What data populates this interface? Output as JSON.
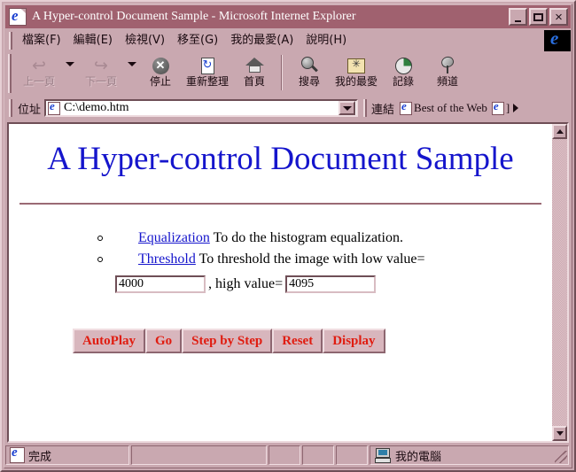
{
  "window": {
    "title": "A Hyper-control Document Sample - Microsoft Internet Explorer",
    "icon": "ie-document-icon",
    "minimize_label": "",
    "maximize_label": "",
    "close_label": "×"
  },
  "menu": {
    "items": [
      {
        "label": "檔案(F)",
        "name": "file"
      },
      {
        "label": "編輯(E)",
        "name": "edit"
      },
      {
        "label": "檢視(V)",
        "name": "view"
      },
      {
        "label": "移至(G)",
        "name": "go"
      },
      {
        "label": "我的最愛(A)",
        "name": "favorites"
      },
      {
        "label": "說明(H)",
        "name": "help"
      }
    ]
  },
  "toolbar": {
    "buttons": [
      {
        "label": "上一頁",
        "name": "back",
        "icon": "back-arrow-icon",
        "disabled": true,
        "dropdown": true
      },
      {
        "label": "下一頁",
        "name": "forward",
        "icon": "forward-arrow-icon",
        "disabled": true,
        "dropdown": true
      },
      {
        "label": "停止",
        "name": "stop",
        "icon": "stop-icon",
        "disabled": false,
        "dropdown": false
      },
      {
        "label": "重新整理",
        "name": "refresh",
        "icon": "refresh-icon",
        "disabled": false,
        "dropdown": false
      },
      {
        "label": "首頁",
        "name": "home",
        "icon": "home-icon",
        "disabled": false,
        "dropdown": false
      },
      {
        "label": "搜尋",
        "name": "search",
        "icon": "search-icon",
        "disabled": false,
        "dropdown": false
      },
      {
        "label": "我的最愛",
        "name": "favorites",
        "icon": "favorites-folder-icon",
        "disabled": false,
        "dropdown": false
      },
      {
        "label": "記錄",
        "name": "history",
        "icon": "history-icon",
        "disabled": false,
        "dropdown": false
      },
      {
        "label": "頻道",
        "name": "channels",
        "icon": "satellite-dish-icon",
        "disabled": false,
        "dropdown": false
      }
    ]
  },
  "address": {
    "label": "位址",
    "value": "C:\\demo.htm",
    "placeholder": "",
    "links_label": "連結",
    "links": [
      {
        "label": "Best of the Web"
      },
      {
        "label": "]"
      }
    ]
  },
  "page": {
    "title": "A Hyper-control Document Sample",
    "items": [
      {
        "link": "Equalization",
        "text": " To do the histogram equalization."
      },
      {
        "link": "Threshold",
        "text": " To threshold the image with low value="
      }
    ],
    "fields": {
      "low_value": "4000",
      "separator": ", high value=",
      "high_value": "4095"
    },
    "buttons": [
      {
        "label": "AutoPlay",
        "name": "autoplay"
      },
      {
        "label": "Go",
        "name": "go"
      },
      {
        "label": "Step by Step",
        "name": "step-by-step"
      },
      {
        "label": "Reset",
        "name": "reset"
      },
      {
        "label": "Display",
        "name": "display"
      }
    ],
    "link_color": "#1515cc",
    "button_text_color": "#e01c10"
  },
  "statusbar": {
    "status": "完成",
    "zone": "我的電腦"
  }
}
